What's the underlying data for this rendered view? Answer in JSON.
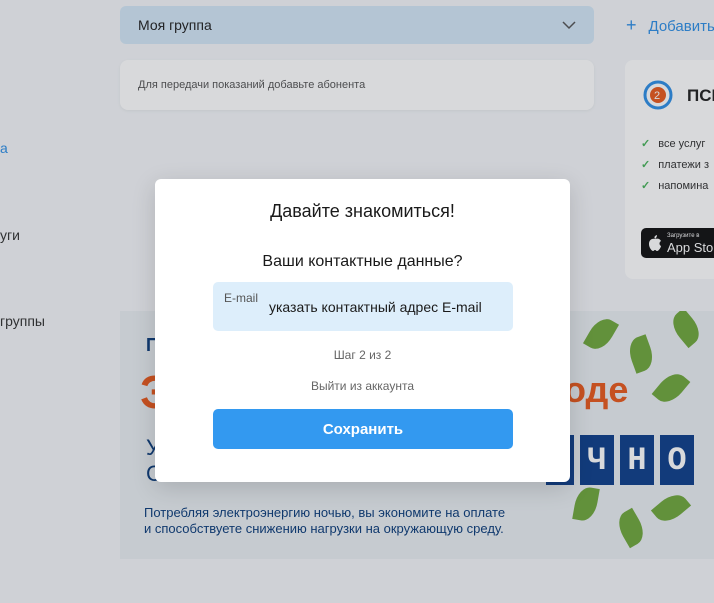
{
  "nav": {
    "items": [
      {
        "label": "а"
      },
      {
        "label": "уги"
      },
      {
        "label": "группы"
      }
    ]
  },
  "group_select": {
    "label": "Моя группа"
  },
  "add_link": {
    "plus": "+",
    "label": "Добавить"
  },
  "hint": {
    "text": "Для передачи показаний добавьте абонента"
  },
  "app_card": {
    "name": "ПСІ",
    "features": [
      "все услуг",
      "платежи з",
      "напомина"
    ],
    "store_small": "Загрузите в",
    "store_big": "App Stor"
  },
  "banner": {
    "brand": "П",
    "big_left": "Э",
    "big_right": "оде",
    "line1": "У",
    "line2": "С",
    "tiles": [
      "О",
      "Ч",
      "Н",
      "О"
    ],
    "footnote_1": "Потребляя электроэнергию ночью, вы экономите на оплате",
    "footnote_2": "и способствуете снижению нагрузки на окружающую среду."
  },
  "modal": {
    "title": "Давайте знакомиться!",
    "subtitle": "Ваши контактные данные?",
    "email_label": "E-mail",
    "email_placeholder": "указать контактный адрес E-mail",
    "step": "Шаг 2 из 2",
    "logout": "Выйти из аккаунта",
    "save": "Сохранить"
  },
  "colors": {
    "accent": "#3399f0",
    "select_bg": "#d4e7f7",
    "field_bg": "#ddeefb",
    "banner_orange": "#e8591d",
    "banner_navy": "#0e3f8a",
    "check_green": "#47b35a"
  },
  "icons": [
    "chevron-down-icon",
    "plus-icon",
    "app-logo-icon",
    "check-icon",
    "apple-icon"
  ]
}
